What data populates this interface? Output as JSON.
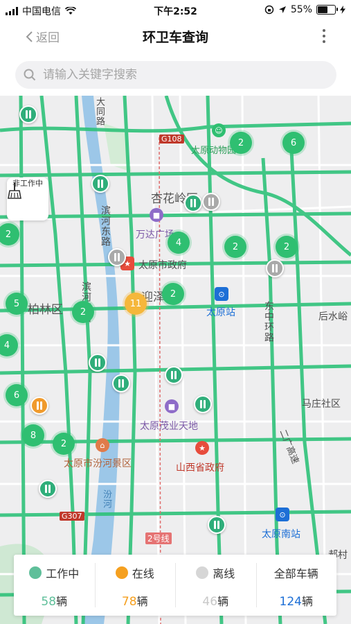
{
  "status_bar": {
    "carrier": "中国电信",
    "time": "下午2:52",
    "battery": "55%"
  },
  "nav": {
    "back_label": "返回",
    "title": "环卫车查询"
  },
  "search": {
    "placeholder": "请输入关键字搜索"
  },
  "filter_button": {
    "label": "非工作中"
  },
  "map": {
    "labels": {
      "dates_road": "大同路",
      "g108": "G108",
      "zoo": "太原动物园",
      "xinghua": "杏花岭区",
      "wanda": "万达广场",
      "binhe_east": "滨河东路",
      "gov": "太原市政府",
      "yingze": "迎泽区",
      "binhe_west": "滨河西路",
      "bolin": "柏林区",
      "station": "太原站",
      "east_ring": "东中环路",
      "houshuiyu": "后水峪",
      "mazhuang": "马庄社区",
      "erguang": "二广高速",
      "maoye": "太原茂业天地",
      "province_gov": "山西省政府",
      "fenhe": "太原市汾河景区",
      "fenhe_river": "汾河",
      "g307": "G307",
      "line2": "2号线",
      "south_station": "太原南站",
      "haocun": "郝村"
    },
    "clusters": [
      "2",
      "6",
      "4",
      "2",
      "2",
      "2",
      "11",
      "2",
      "5",
      "2",
      "4",
      "6",
      "8",
      "2"
    ],
    "truck_icon": "sanitation-truck-icon"
  },
  "legend": {
    "working": {
      "label": "工作中",
      "count": "58",
      "unit": "辆",
      "color": "#5fbf9a"
    },
    "online": {
      "label": "在线",
      "count": "78",
      "unit": "辆",
      "color": "#f5a020"
    },
    "offline": {
      "label": "离线",
      "count": "46",
      "unit": "辆",
      "color": "#d6d6d6"
    },
    "all": {
      "label": "全部车辆",
      "count": "124",
      "unit": "辆",
      "color": "#1d6fd6"
    }
  }
}
